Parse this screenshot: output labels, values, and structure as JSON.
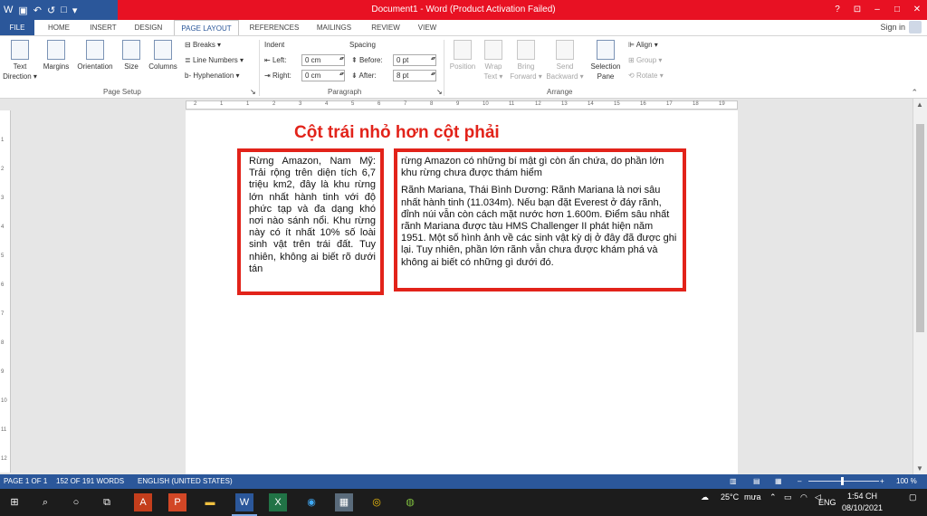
{
  "title": "Document1 - Word (Product Activation Failed)",
  "quick_access": {
    "undo": "↶",
    "redo": "↺",
    "new": "□"
  },
  "window_controls": {
    "help": "?",
    "restore_ribbon": "⊡",
    "minimize": "–",
    "maximize": "□",
    "close": "✕"
  },
  "tabs": [
    {
      "label": "FILE"
    },
    {
      "label": "HOME"
    },
    {
      "label": "INSERT"
    },
    {
      "label": "DESIGN"
    },
    {
      "label": "PAGE LAYOUT"
    },
    {
      "label": "REFERENCES"
    },
    {
      "label": "MAILINGS"
    },
    {
      "label": "REVIEW"
    },
    {
      "label": "VIEW"
    }
  ],
  "sign_in": "Sign in",
  "ribbon": {
    "page_setup": {
      "text_direction": "Text Direction ▾",
      "margins": "Margins",
      "orientation": "Orientation",
      "size": "Size",
      "columns": "Columns",
      "breaks": "Breaks ▾",
      "line_numbers": "Line Numbers ▾",
      "hyphenation": "Hyphenation ▾",
      "group_label": "Page Setup"
    },
    "paragraph": {
      "indent_label": "Indent",
      "spacing_label": "Spacing",
      "left_label": "Left:",
      "right_label": "Right:",
      "before_label": "Before:",
      "after_label": "After:",
      "left_value": "0 cm",
      "right_value": "0 cm",
      "before_value": "0 pt",
      "after_value": "8 pt",
      "group_label": "Paragraph"
    },
    "arrange": {
      "position": "Position",
      "wrap_text": "Wrap Text ▾",
      "bring_forward": "Bring Forward ▾",
      "send_backward": "Send Backward ▾",
      "selection_pane": "Selection Pane",
      "align": "Align ▾",
      "group": "Group ▾",
      "rotate": "Rotate ▾",
      "group_label": "Arrange"
    }
  },
  "ruler_ticks": [
    "2",
    "1",
    "1",
    "2",
    "3",
    "4",
    "5",
    "6",
    "7",
    "8",
    "9",
    "10",
    "11",
    "12",
    "13",
    "14",
    "15",
    "16",
    "17",
    "18",
    "19"
  ],
  "vruler_ticks": [
    "1",
    "2",
    "3",
    "4",
    "5",
    "6",
    "7",
    "8",
    "9",
    "10",
    "11",
    "12"
  ],
  "document": {
    "heading": "Cột trái nhỏ hơn cột phải",
    "left_column": "Rừng Amazon, Nam Mỹ: Trải rộng trên diện tích 6,7 triệu km2, đây là khu rừng lớn nhất hành tinh với độ phức tạp và đa dạng khó nơi nào sánh nổi. Khu rừng này có ít nhất 10% số loài sinh vật trên trái đất. Tuy nhiên, không ai biết rõ dưới tán",
    "right_column": [
      "rừng Amazon có những bí mật gì còn ẩn chứa, do phần lớn khu rừng chưa được thám hiểm",
      "Rãnh Mariana, Thái Bình Dương: Rãnh Mariana là nơi sâu nhất hành tinh (11.034m). Nếu bạn đặt Everest ở đáy rãnh, đỉnh núi vẫn còn cách mặt nước hơn 1.600m. Điểm sâu nhất rãnh Mariana được tàu HMS Challenger II phát hiện năm 1951. Một số hình ảnh về các sinh vật kỳ dị ở đây đã được ghi lại. Tuy nhiên, phần lớn rãnh vẫn chưa được khám phá và không ai biết có những gì dưới đó."
    ]
  },
  "status": {
    "page": "PAGE 1 OF 1",
    "words": "152 OF 191 WORDS",
    "language": "ENGLISH (UNITED STATES)",
    "zoom": "100 %",
    "zoom_minus": "–",
    "zoom_plus": "+"
  },
  "taskbar": {
    "weather": "25°C",
    "weather_desc": "mưa",
    "lang": "ENG",
    "time": "1:54 CH",
    "date": "08/10/2021"
  },
  "colors": {
    "title_red": "#e81123",
    "word_blue": "#2b579a",
    "accent_red": "#e2231a"
  }
}
